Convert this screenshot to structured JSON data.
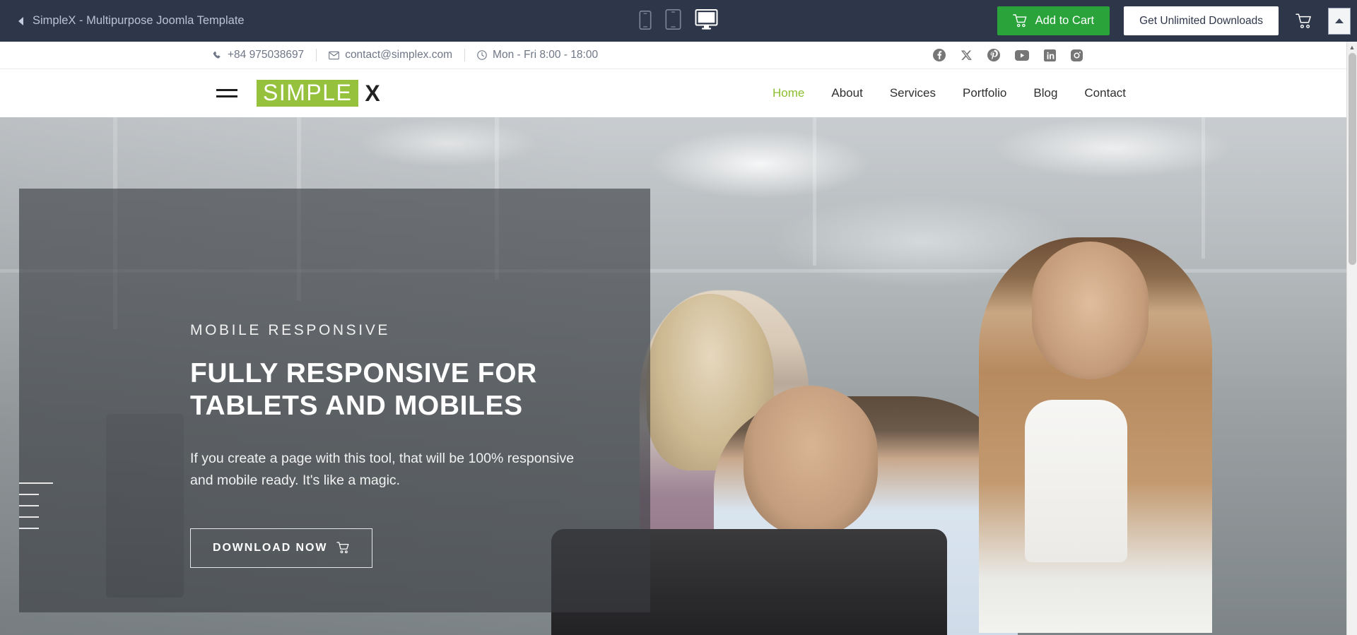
{
  "preview_bar": {
    "back_label": "SimpleX - Multipurpose Joomla Template",
    "devices": [
      {
        "name": "mobile",
        "active": false
      },
      {
        "name": "tablet",
        "active": false
      },
      {
        "name": "desktop",
        "active": true
      }
    ],
    "add_to_cart_label": "Add to Cart",
    "unlimited_label": "Get Unlimited Downloads",
    "cart_icon": "shopping-cart-icon",
    "collapse_icon": "chevron-up-icon",
    "colors": {
      "bar_bg": "#2e374a",
      "cart_green": "#2aa33b"
    }
  },
  "contact_bar": {
    "phone": "+84 975038697",
    "email": "contact@simplex.com",
    "hours": "Mon - Fri 8:00 - 18:00",
    "social": [
      {
        "name": "facebook-icon",
        "label": "Facebook"
      },
      {
        "name": "x-twitter-icon",
        "label": "X"
      },
      {
        "name": "pinterest-icon",
        "label": "Pinterest"
      },
      {
        "name": "youtube-icon",
        "label": "YouTube"
      },
      {
        "name": "linkedin-icon",
        "label": "LinkedIn"
      },
      {
        "name": "instagram-icon",
        "label": "Instagram"
      }
    ]
  },
  "header": {
    "menu_icon": "hamburger-icon",
    "logo": {
      "primary": "SIMPLE",
      "secondary": "X",
      "accent": "#96c13d"
    },
    "nav": [
      {
        "label": "Home",
        "active": true
      },
      {
        "label": "About",
        "active": false
      },
      {
        "label": "Services",
        "active": false
      },
      {
        "label": "Portfolio",
        "active": false
      },
      {
        "label": "Blog",
        "active": false
      },
      {
        "label": "Contact",
        "active": false
      }
    ]
  },
  "hero": {
    "eyebrow": "MOBILE RESPONSIVE",
    "title": "FULLY RESPONSIVE FOR TABLETS AND MOBILES",
    "text": "If you create a page with this tool, that will be 100% responsive and mobile ready. It's like a magic.",
    "cta_label": "DOWNLOAD NOW",
    "cta_icon": "shopping-cart-icon"
  }
}
